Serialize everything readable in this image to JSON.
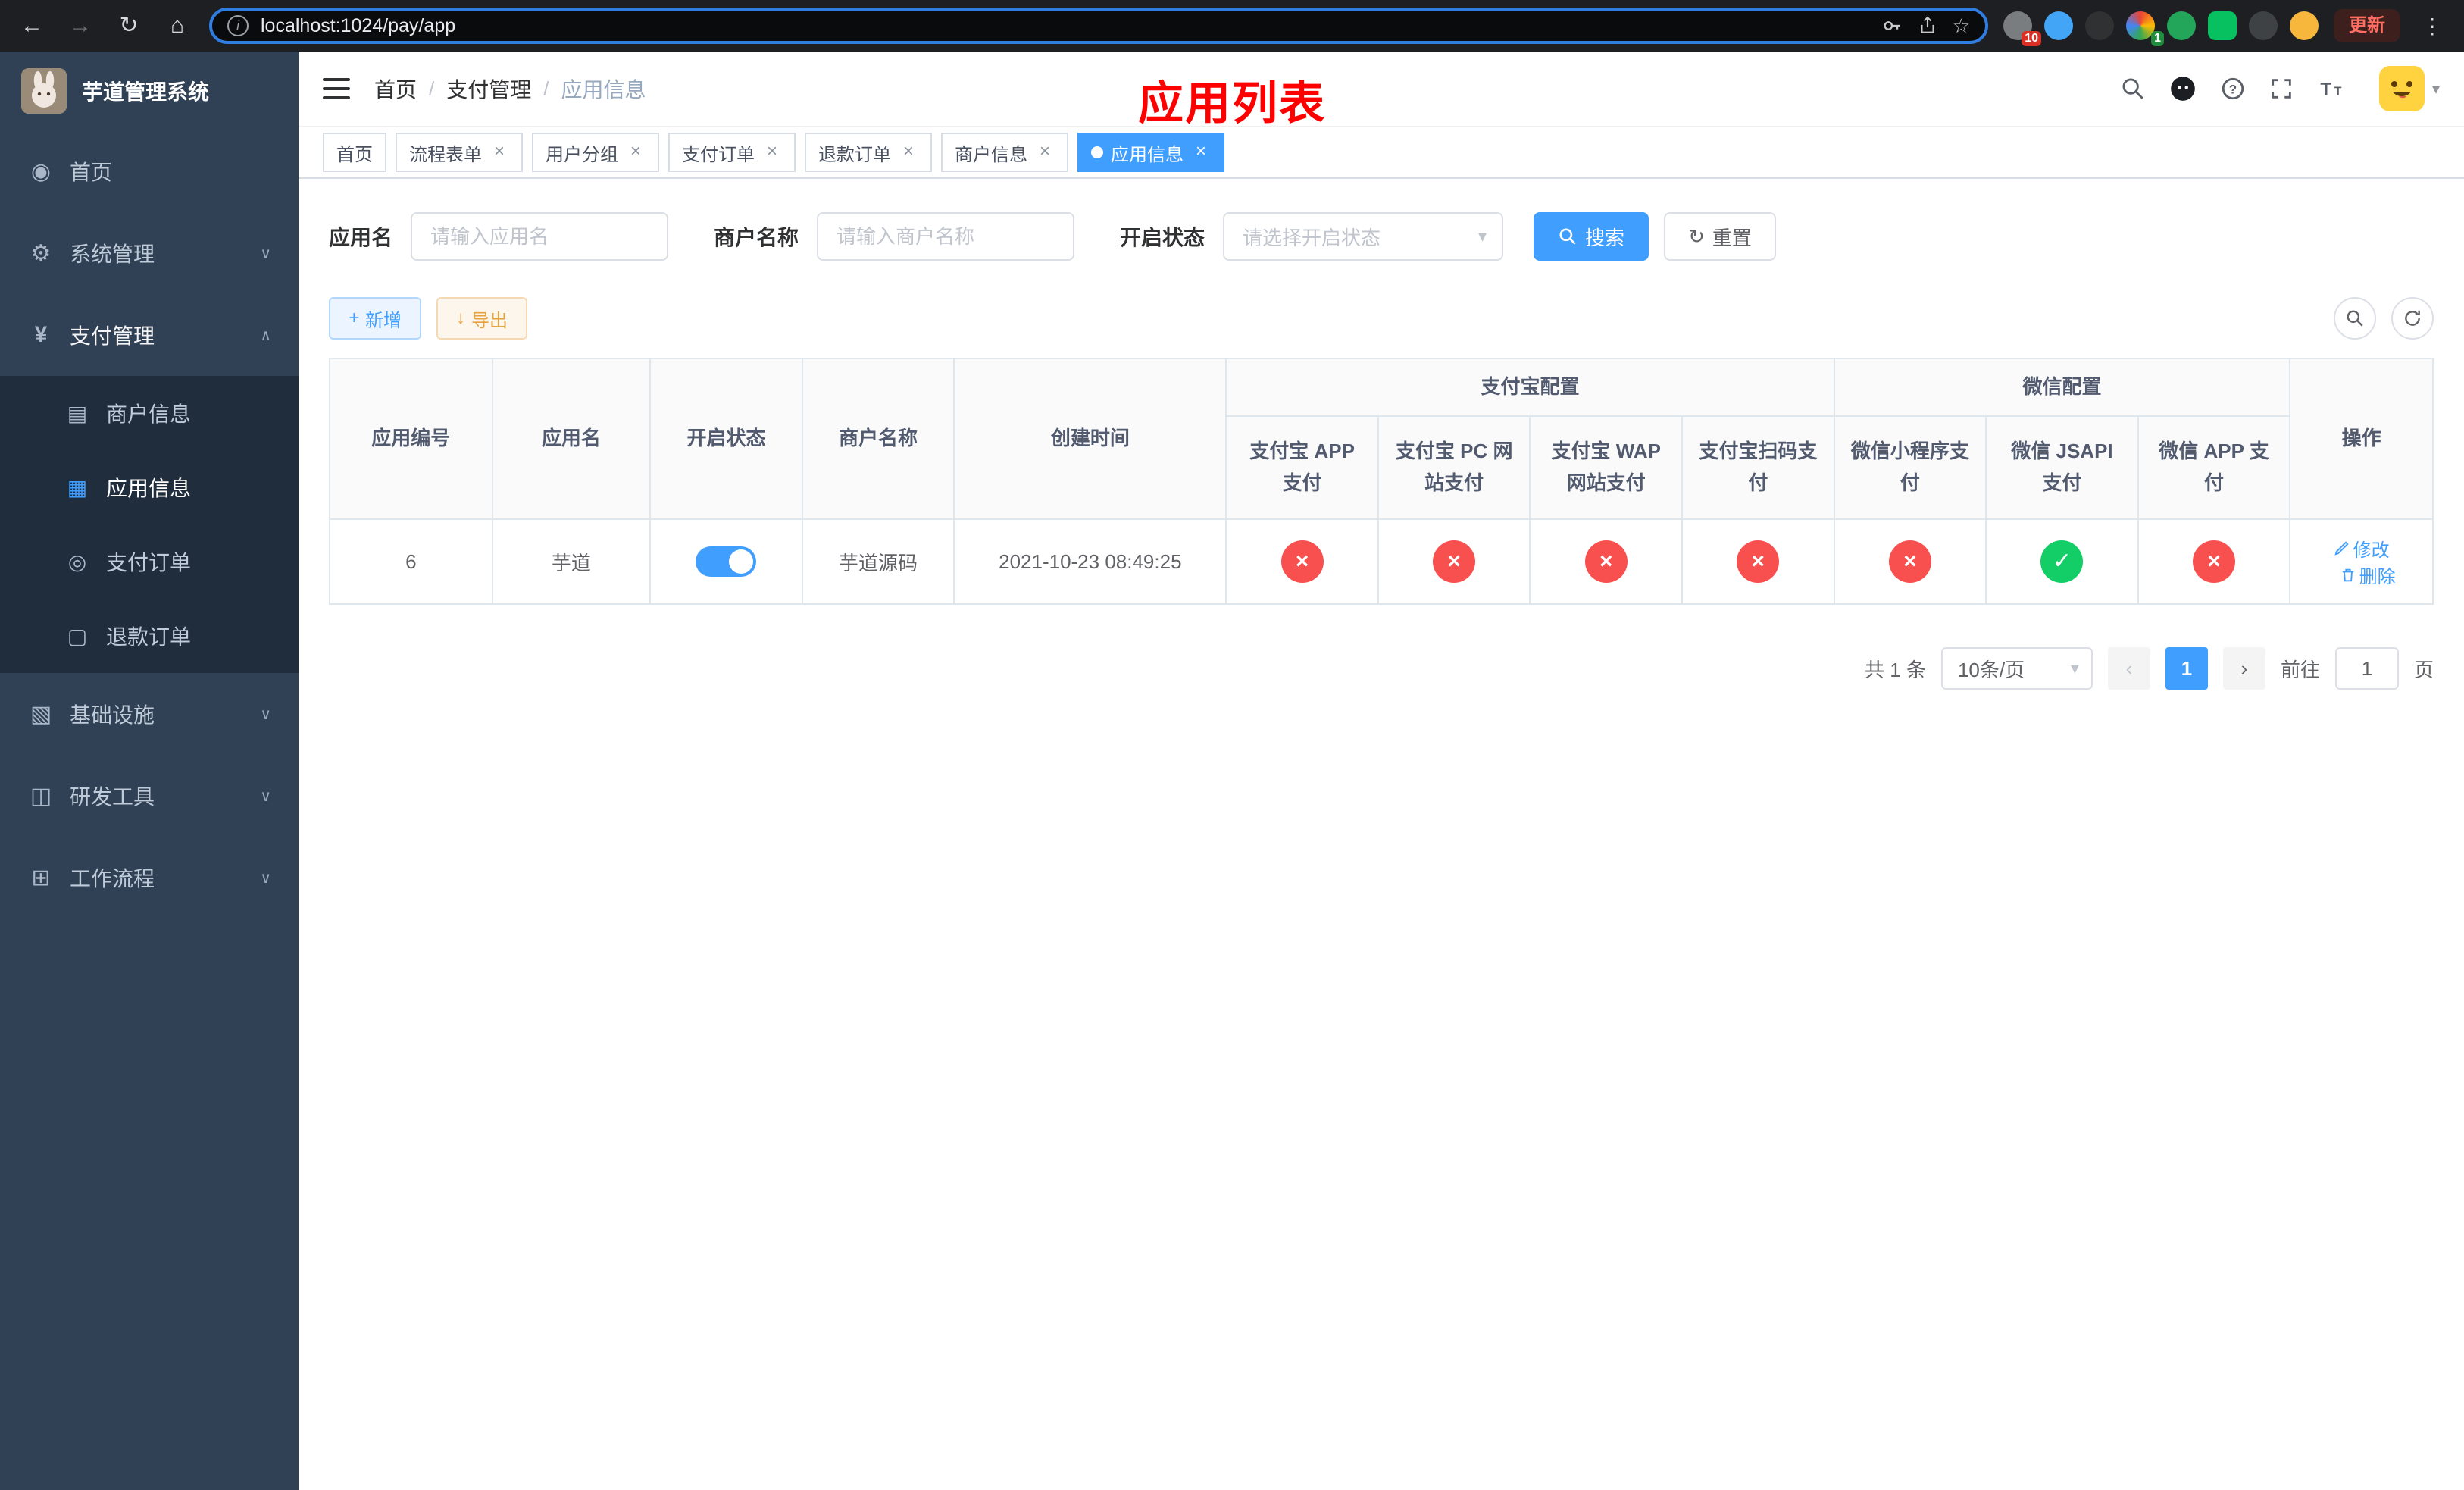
{
  "colors": {
    "accent": "#409eff",
    "success": "#13ce66",
    "error": "#f7504f",
    "title": "#ff0000"
  },
  "browser": {
    "url": "localhost:1024/pay/app",
    "update_button": "更新",
    "ext_badge_puzzle": "10",
    "ext_badge_profile": "1"
  },
  "sidebar": {
    "logo_title": "芋道管理系统",
    "items": [
      {
        "label": "首页"
      },
      {
        "label": "系统管理"
      },
      {
        "label": "支付管理"
      },
      {
        "label": "基础设施"
      },
      {
        "label": "研发工具"
      },
      {
        "label": "工作流程"
      }
    ],
    "pay_submenu": [
      {
        "label": "商户信息"
      },
      {
        "label": "应用信息"
      },
      {
        "label": "支付订单"
      },
      {
        "label": "退款订单"
      }
    ]
  },
  "header": {
    "breadcrumb": [
      "首页",
      "支付管理",
      "应用信息"
    ],
    "page_title": "应用列表"
  },
  "tabs": [
    {
      "label": "首页"
    },
    {
      "label": "流程表单"
    },
    {
      "label": "用户分组"
    },
    {
      "label": "支付订单"
    },
    {
      "label": "退款订单"
    },
    {
      "label": "商户信息"
    },
    {
      "label": "应用信息"
    }
  ],
  "filters": {
    "app_name_label": "应用名",
    "app_name_placeholder": "请输入应用名",
    "merchant_label": "商户名称",
    "merchant_placeholder": "请输入商户名称",
    "status_label": "开启状态",
    "status_placeholder": "请选择开启状态",
    "search_button": "搜索",
    "reset_button": "重置"
  },
  "toolbar": {
    "add_button": "新增",
    "export_button": "导出"
  },
  "table": {
    "columns": {
      "app_id": "应用编号",
      "app_name": "应用名",
      "status": "开启状态",
      "merchant": "商户名称",
      "created": "创建时间",
      "alipay_group": "支付宝配置",
      "wechat_group": "微信配置",
      "alipay_app": "支付宝 APP 支付",
      "alipay_pc": "支付宝 PC 网站支付",
      "alipay_wap": "支付宝 WAP 网站支付",
      "alipay_qr": "支付宝扫码支付",
      "wx_mini": "微信小程序支付",
      "wx_jsapi": "微信 JSAPI 支付",
      "wx_app": "微信 APP 支付",
      "actions": "操作"
    },
    "rows": [
      {
        "app_id": "6",
        "app_name": "芋道",
        "status_enabled": true,
        "merchant": "芋道源码",
        "created": "2021-10-23 08:49:25",
        "channels": [
          "error",
          "error",
          "error",
          "error",
          "error",
          "success",
          "error"
        ],
        "edit_label": "修改",
        "delete_label": "删除"
      }
    ]
  },
  "pagination": {
    "total": "共 1 条",
    "page_size": "10条/页",
    "current_page": "1",
    "goto_prefix": "前往",
    "goto_value": "1",
    "goto_suffix": "页"
  }
}
